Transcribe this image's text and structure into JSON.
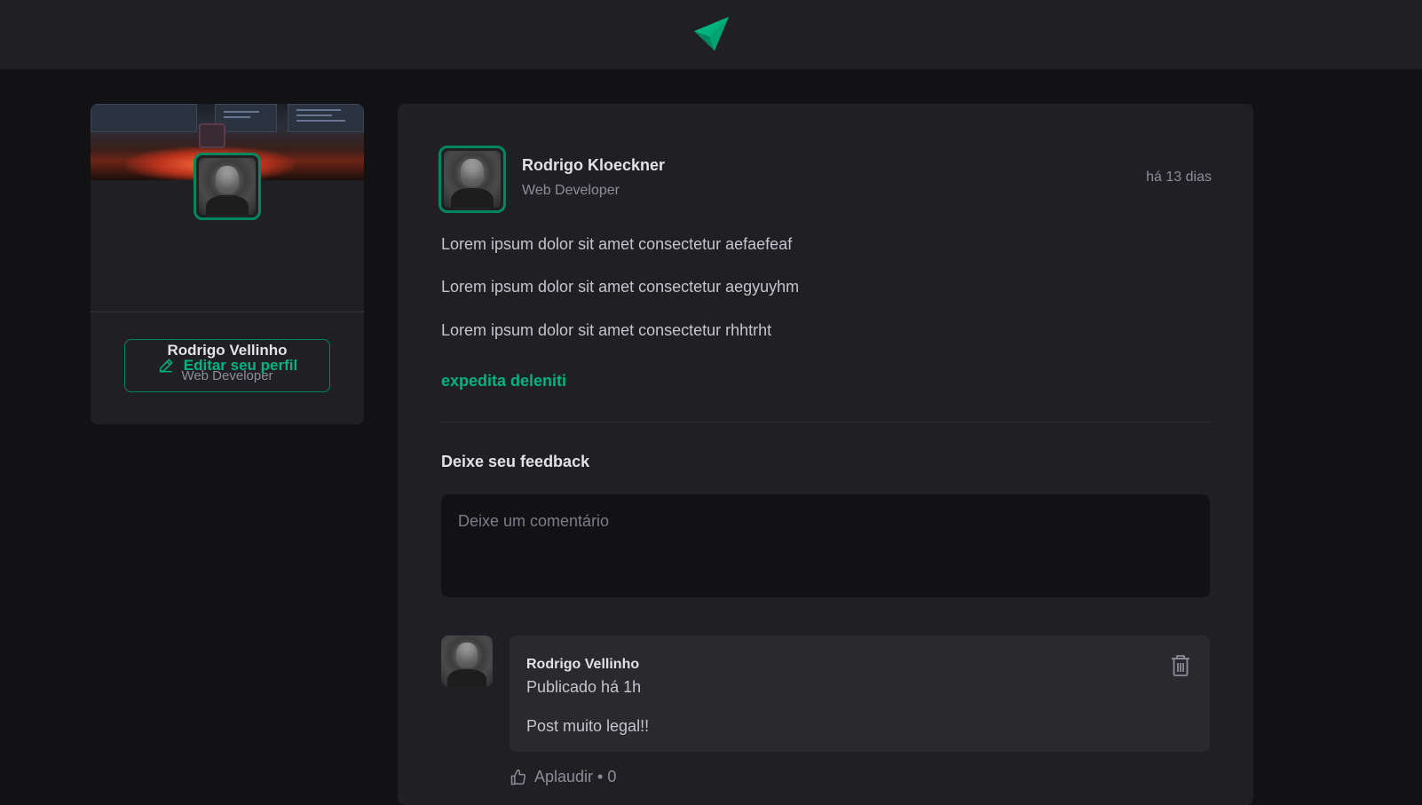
{
  "header": {
    "logo_icon": "paper-plane-icon",
    "accent": "#00b37e"
  },
  "sidebar": {
    "cover_image": "desk-setup-image",
    "name": "Rodrigo Vellinho",
    "role": "Web Developer",
    "edit_button": {
      "label": "Editar seu perfil",
      "icon": "pencil-icon"
    }
  },
  "post": {
    "author": {
      "name": "Rodrigo Kloeckner",
      "role": "Web Developer"
    },
    "published": "há 13 dias",
    "content": [
      "Lorem ipsum dolor sit amet consectetur aefaefeaf",
      "Lorem ipsum dolor sit amet consectetur aegyuyhm",
      "Lorem ipsum dolor sit amet consectetur rhhtrht"
    ],
    "link": "expedita deleniti",
    "feedback": {
      "title": "Deixe seu feedback",
      "placeholder": "Deixe um comentário"
    },
    "comments": [
      {
        "author": "Rodrigo Vellinho",
        "time": "Publicado há 1h",
        "text": "Post muito legal!!",
        "delete_icon": "trash-icon",
        "applaud_label": "Aplaudir • 0",
        "applaud_icon": "thumbs-up-icon"
      }
    ]
  }
}
